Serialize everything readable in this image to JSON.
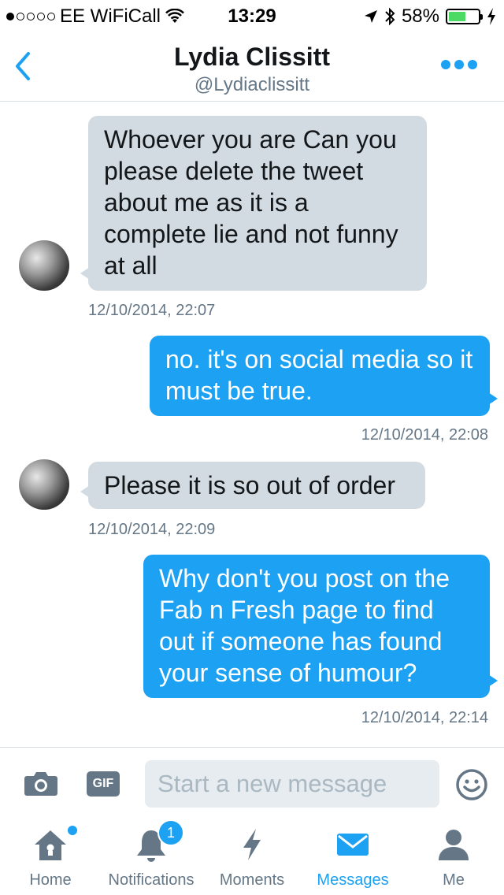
{
  "status_bar": {
    "carrier": "EE WiFiCall",
    "time": "13:29",
    "battery": "58%",
    "signal_bars_filled": 1,
    "signal_bars_total": 5
  },
  "header": {
    "name": "Lydia Clissitt",
    "handle": "@Lydiaclissitt"
  },
  "messages": [
    {
      "direction": "incoming",
      "text": "Whoever you are Can you please delete the tweet about me as it is a complete lie and not funny at all",
      "timestamp": "12/10/2014, 22:07"
    },
    {
      "direction": "outgoing",
      "text": "no. it's on social media so it must be true.",
      "timestamp": "12/10/2014, 22:08"
    },
    {
      "direction": "incoming",
      "text": "Please it is so out of order",
      "timestamp": "12/10/2014, 22:09"
    },
    {
      "direction": "outgoing",
      "text": "Why don't you post on the Fab n Fresh page to find out if someone has found your sense of humour?",
      "timestamp": "12/10/2014, 22:14"
    }
  ],
  "composer": {
    "gif_label": "GIF",
    "placeholder": "Start a new message"
  },
  "tabs": [
    {
      "label": "Home",
      "icon": "home-icon"
    },
    {
      "label": "Notifications",
      "icon": "bell-icon",
      "badge": "1"
    },
    {
      "label": "Moments",
      "icon": "lightning-icon"
    },
    {
      "label": "Messages",
      "icon": "envelope-icon",
      "active": true
    },
    {
      "label": "Me",
      "icon": "person-icon"
    }
  ],
  "colors": {
    "accent": "#1da1f2",
    "incoming_bubble": "#d2dbe1",
    "secondary_text": "#657786",
    "battery_fill": "#4cd964"
  }
}
